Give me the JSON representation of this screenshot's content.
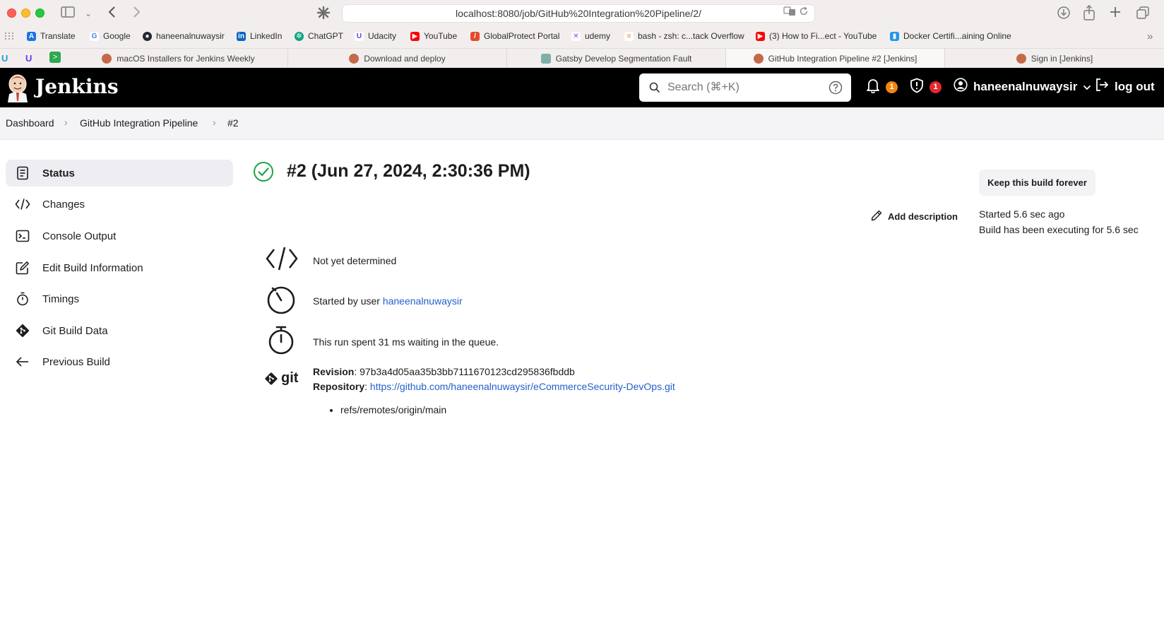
{
  "browser": {
    "url": "localhost:8080/job/GitHub%20Integration%20Pipeline/2/",
    "bookmarks": [
      {
        "label": "Translate",
        "color": "#1a73e8"
      },
      {
        "label": "Google",
        "color": "#4285f4"
      },
      {
        "label": "haneenalnuwaysir",
        "color": "#24292f"
      },
      {
        "label": "LinkedIn",
        "color": "#0a66c2"
      },
      {
        "label": "ChatGPT",
        "color": "#10a37f"
      },
      {
        "label": "Udacity",
        "color": "#5b3df5"
      },
      {
        "label": "YouTube",
        "color": "#ff0000"
      },
      {
        "label": "GlobalProtect Portal",
        "color": "#e34b2b"
      },
      {
        "label": "udemy",
        "color": "#a435f0"
      },
      {
        "label": "bash - zsh: c...tack Overflow",
        "color": "#f48024"
      },
      {
        "label": "(3) How to Fi...ect - YouTube",
        "color": "#ff0000"
      },
      {
        "label": "Docker Certifi...aining Online",
        "color": "#2496ed"
      }
    ],
    "tabs": [
      {
        "label": "macOS Installers for Jenkins Weekly",
        "color": "#c46a4a",
        "active": false
      },
      {
        "label": "Download and deploy",
        "color": "#c46a4a",
        "active": false
      },
      {
        "label": "Gatsby Develop Segmentation Fault",
        "color": "#7fb0a7",
        "active": false
      },
      {
        "label": "GitHub Integration Pipeline #2 [Jenkins]",
        "color": "#c46a4a",
        "active": true
      },
      {
        "label": "Sign in [Jenkins]",
        "color": "#c46a4a",
        "active": false
      }
    ]
  },
  "header": {
    "title": "Jenkins",
    "search_placeholder": "Search (⌘+K)",
    "notifications_count": "1",
    "security_count": "1",
    "username": "haneenalnuwaysir",
    "logout_label": "log out"
  },
  "breadcrumb": [
    "Dashboard",
    "GitHub Integration Pipeline",
    "#2"
  ],
  "sidebar": {
    "items": [
      {
        "label": "Status",
        "icon": "status-icon",
        "active": true
      },
      {
        "label": "Changes",
        "icon": "code-icon",
        "active": false
      },
      {
        "label": "Console Output",
        "icon": "terminal-icon",
        "active": false
      },
      {
        "label": "Edit Build Information",
        "icon": "edit-icon",
        "active": false
      },
      {
        "label": "Timings",
        "icon": "stopwatch-icon",
        "active": false
      },
      {
        "label": "Git Build Data",
        "icon": "git-icon",
        "active": false
      },
      {
        "label": "Previous Build",
        "icon": "arrow-left-icon",
        "active": false
      }
    ]
  },
  "build": {
    "title": "#2 (Jun 27, 2024, 2:30:36 PM)",
    "keep_label": "Keep this build forever",
    "add_description_label": "Add description",
    "started_ago": "Started 5.6 sec ago",
    "executing_for": "Build has been executing for 5.6 sec",
    "changes_text": "Not yet determined",
    "started_by_prefix": "Started by user",
    "started_by_user": "haneenalnuwaysir",
    "queue_text": "This run spent 31 ms waiting in the queue.",
    "revision_label": "Revision",
    "revision_value": "97b3a4d05aa35b3bb7111670123cd295836fbddb",
    "repository_label": "Repository",
    "repository_url": "https://github.com/haneenalnuwaysir/eCommerceSecurity-DevOps.git",
    "git_label": "git",
    "branches": [
      "refs/remotes/origin/main"
    ]
  },
  "colors": {
    "success_green": "#1ea446",
    "link_blue": "#2461c9",
    "notification_orange": "#f1860d",
    "security_red": "#e6272e"
  }
}
